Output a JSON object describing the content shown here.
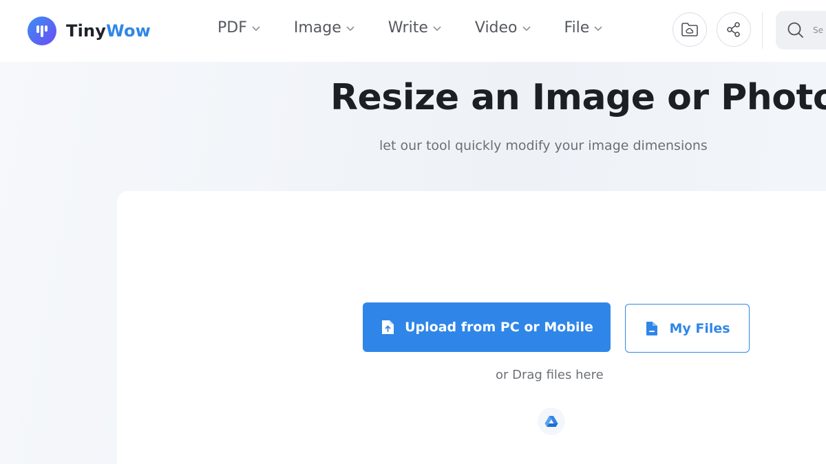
{
  "brand": {
    "part1": "Tiny",
    "part2": "Wow",
    "accent": "#2f86e8"
  },
  "nav": [
    {
      "label": "PDF"
    },
    {
      "label": "Image"
    },
    {
      "label": "Write"
    },
    {
      "label": "Video"
    },
    {
      "label": "File"
    }
  ],
  "header_icons": {
    "files": "folder-cloud-icon",
    "share": "share-icon",
    "search": "search-icon"
  },
  "search": {
    "placeholder": "Se"
  },
  "hero": {
    "title": "Resize an Image or Photo",
    "subtitle": "let our tool quickly modify your image dimensions"
  },
  "upload": {
    "upload_label": "Upload from PC or Mobile",
    "my_files_label": "My Files",
    "drag_text": "or Drag files here",
    "drive_icon": "google-drive-icon"
  }
}
